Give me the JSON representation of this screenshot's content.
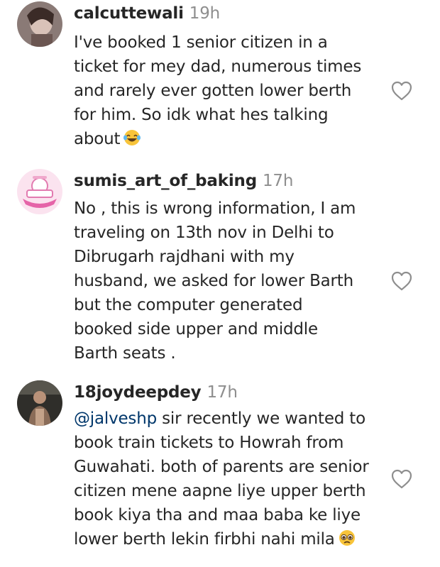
{
  "comments": [
    {
      "username": "calcuttewali",
      "time": "19h",
      "lines": [
        "I've booked 1 senior citizen in a",
        "ticket for mey dad, numerous times",
        "and rarely ever gotten lower berth",
        "for him. So idk what hes talking",
        "about"
      ],
      "emoji": "laughing-crying-emoji",
      "liked": false
    },
    {
      "username": "sumis_art_of_baking",
      "time": "17h",
      "lines": [
        "No , this is wrong information, I am",
        "traveling on 13th nov in Delhi to",
        "Dibrugarh rajdhani with my",
        "husband, we asked for lower Barth",
        "but the computer generated",
        "booked side upper and middle",
        "Barth seats ."
      ],
      "liked": false
    },
    {
      "username": "18joydeepdey",
      "time": "17h",
      "mention": "@jalveshp",
      "first_line_rest": " sir recently we wanted to",
      "lines": [
        "book train tickets to Howrah from",
        "Guwahati. both of parents are senior",
        "citizen mene aapne liye upper berth",
        "book kiya tha and maa baba ke liye",
        "lower berth lekin firbhi nahi mila"
      ],
      "emoji": "pleading-face-emoji",
      "liked": false
    }
  ],
  "colors": {
    "text": "#262626",
    "timestamp": "#8e8e8e",
    "mention": "#00376b",
    "heart_outline": "#8e8e8e"
  },
  "icons": {
    "like": "heart-outline-icon"
  }
}
